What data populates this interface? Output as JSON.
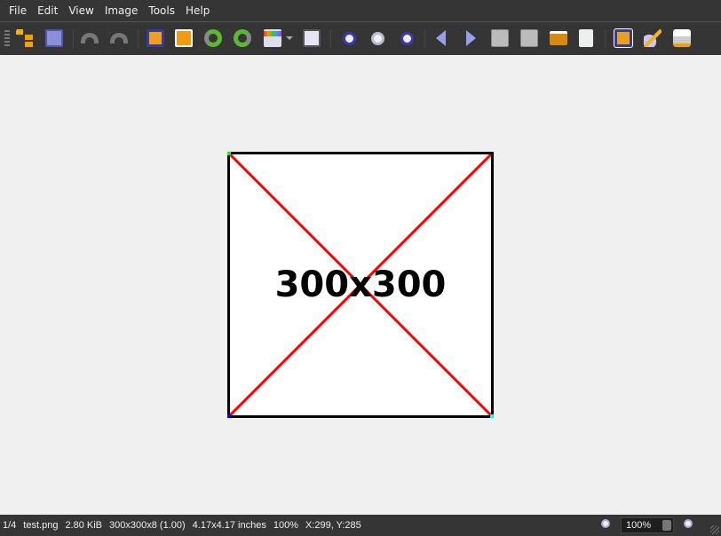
{
  "menu": [
    "File",
    "Edit",
    "View",
    "Image",
    "Tools",
    "Help"
  ],
  "toolbar": [
    "open-folder",
    "save",
    "undo",
    "redo",
    "crop",
    "resize",
    "rotate-left",
    "rotate-right",
    "adjust-colors",
    "color-dropdown",
    "histogram",
    "zoom-in",
    "zoom-actual",
    "zoom-out",
    "previous",
    "next",
    "prev-page",
    "next-page",
    "slideshow",
    "image-info",
    "fit-window",
    "annotate",
    "print"
  ],
  "image": {
    "label": "300x300",
    "background": "#ffffff",
    "border": "#000000",
    "line_color": "#ff0000"
  },
  "status": {
    "index": "1/4",
    "filename": "test.png",
    "filesize": "2.80 KiB",
    "dimensions": "300x300x8 (1.00)",
    "print_size": "4.17x4.17 inches",
    "zoom": "100%",
    "coords": "X:299, Y:285",
    "zoom_field": "100%"
  }
}
